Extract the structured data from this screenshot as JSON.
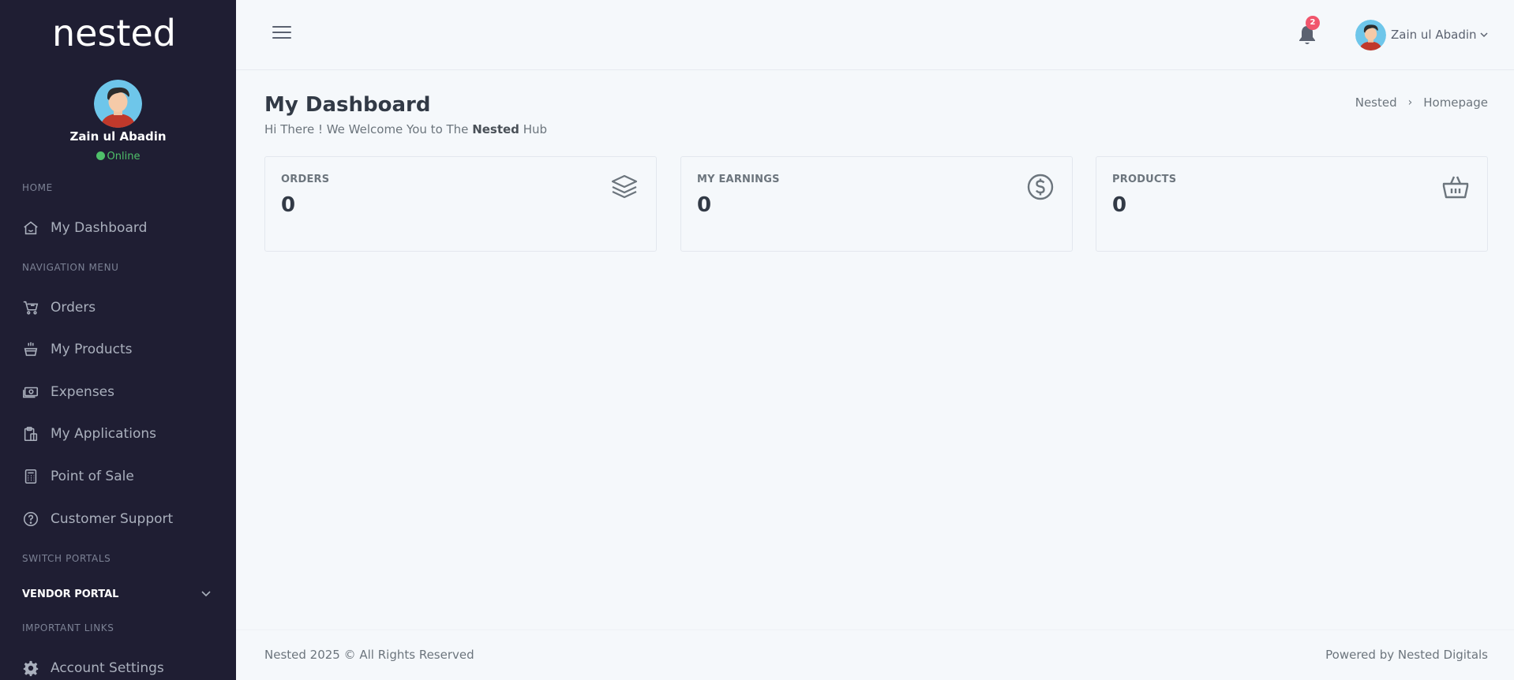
{
  "sidebar": {
    "logo_text": "nested",
    "user": {
      "name": "Zain ul Abadin",
      "status": "Online"
    },
    "sections": {
      "home": "HOME",
      "navigation": "NAVIGATION MENU",
      "switch_portals": "SWITCH PORTALS",
      "important_links": "IMPORTANT LINKS"
    },
    "home_items": [
      {
        "label": "My Dashboard",
        "icon": "home-icon"
      }
    ],
    "nav_items": [
      {
        "label": "Orders",
        "icon": "cart-icon"
      },
      {
        "label": "My Products",
        "icon": "basket-icon"
      },
      {
        "label": "Expenses",
        "icon": "cash-icon"
      },
      {
        "label": "My Applications",
        "icon": "clipboard-icon"
      },
      {
        "label": "Point of Sale",
        "icon": "calculator-icon"
      },
      {
        "label": "Customer Support",
        "icon": "help-circle-icon"
      }
    ],
    "portal_label": "VENDOR PORTAL",
    "link_items": [
      {
        "label": "Account Settings",
        "icon": "gear-icon"
      }
    ]
  },
  "topbar": {
    "notification_count": "2",
    "user_name": "Zain ul Abadin"
  },
  "page": {
    "title": "My Dashboard",
    "subtitle_prefix": "Hi There ! We Welcome You to The ",
    "subtitle_brand": "Nested",
    "subtitle_suffix": " Hub",
    "breadcrumb": [
      "Nested",
      "Homepage"
    ]
  },
  "cards": [
    {
      "label": "ORDERS",
      "value": "0",
      "icon": "layers-icon"
    },
    {
      "label": "MY EARNINGS",
      "value": "0",
      "icon": "dollar-circle-icon"
    },
    {
      "label": "PRODUCTS",
      "value": "0",
      "icon": "basket-icon"
    }
  ],
  "footer": {
    "left": "Nested 2025 © All Rights Reserved",
    "right": "Powered by Nested Digitals"
  },
  "colors": {
    "sidebar_bg": "#1f1e33",
    "page_bg": "#f5f8fb",
    "online": "#4fc06a",
    "badge": "#f1556c"
  }
}
